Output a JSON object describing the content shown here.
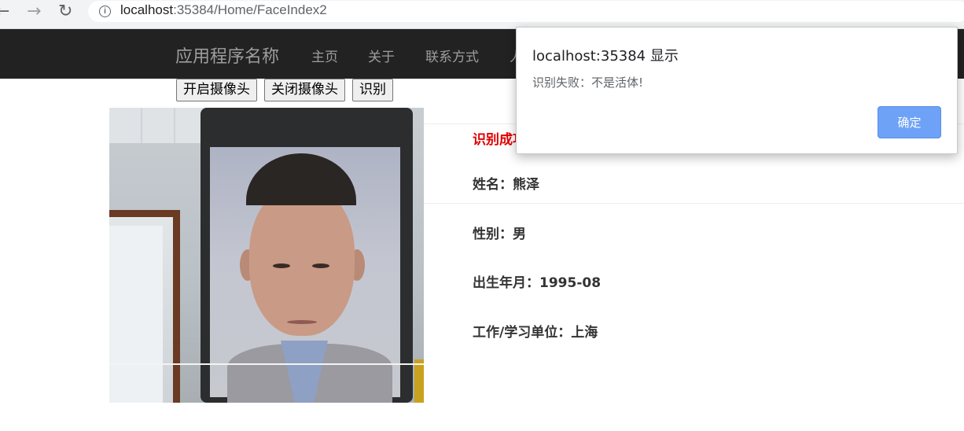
{
  "browser": {
    "url_host": "localhost",
    "url_rest": ":35384/Home/FaceIndex2",
    "icons": {
      "back": "arrow-left-icon",
      "forward": "arrow-right-icon",
      "reload": "reload-icon",
      "info": "info-icon"
    }
  },
  "navbar": {
    "brand": "应用程序名称",
    "links": [
      "主页",
      "关于",
      "联系方式",
      "人"
    ]
  },
  "controls": {
    "open_camera": "开启摄像头",
    "close_camera": "关闭摄像头",
    "recognize": "识别"
  },
  "result": {
    "status": "识别成功",
    "name": "姓名：熊泽",
    "gender": "性别：男",
    "birth": "出生年月：1995-08",
    "work": "工作/学习单位：上海",
    "status_color": "#e00000"
  },
  "dialog": {
    "title": "localhost:35384 显示",
    "message": "识别失败：不是活体!",
    "ok_label": "确定",
    "ok_color": "#6da2f7"
  }
}
